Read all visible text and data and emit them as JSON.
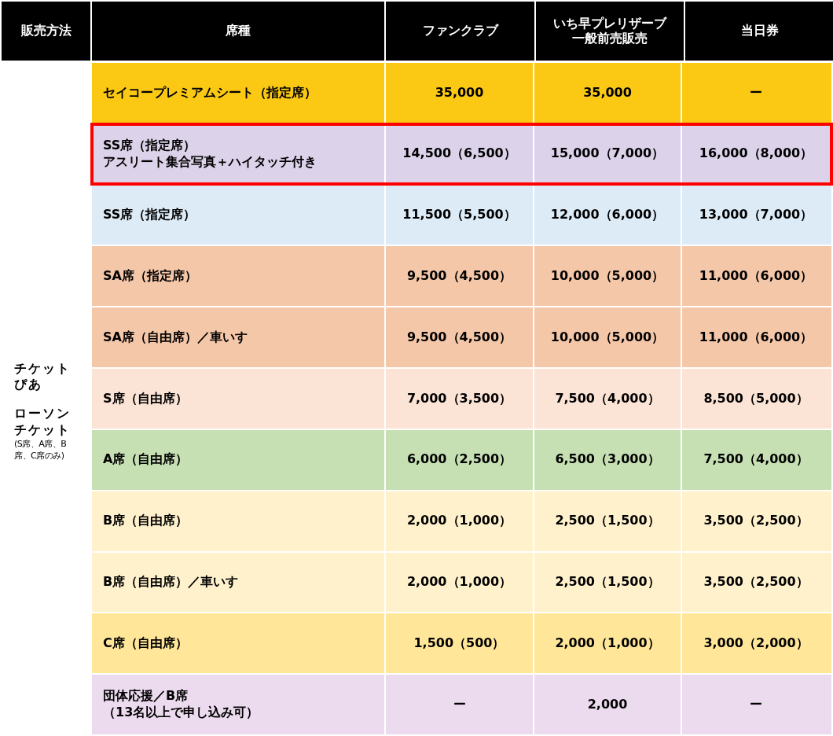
{
  "header": [
    "販売方法",
    "席種",
    "ファンクラブ",
    "いち早プレリザーブ一般前売販売",
    "当日券"
  ],
  "sales_methods": [
    {
      "kind": "main",
      "text": "チケットぴあ"
    },
    {
      "kind": "main",
      "text": "ローソンチケット"
    },
    {
      "kind": "note",
      "text": "(S席、A席、B席、C席のみ)"
    }
  ],
  "rows": [
    {
      "seat": "セイコープレミアムシート（指定席）",
      "fanclub": "35,000",
      "presale": "35,000",
      "day": "ー",
      "color": "#fbc913",
      "highlighted": false
    },
    {
      "seat": [
        "SS席（指定席）",
        "アスリート集合写真＋ハイタッチ付き"
      ],
      "fanclub": "14,500（6,500）",
      "presale": "15,000（7,000）",
      "day": "16,000（8,000）",
      "color": "#dcd2ea",
      "highlighted": true
    },
    {
      "seat": "SS席（指定席）",
      "fanclub": "11,500（5,500）",
      "presale": "12,000（6,000）",
      "day": "13,000（7,000）",
      "color": "#ddebf7",
      "highlighted": false
    },
    {
      "seat": "SA席（指定席）",
      "fanclub": "9,500（4,500）",
      "presale": "10,000（5,000）",
      "day": "11,000（6,000）",
      "color": "#f5c7a9",
      "highlighted": false
    },
    {
      "seat": "SA席（自由席）／車いす",
      "fanclub": "9,500（4,500）",
      "presale": "10,000（5,000）",
      "day": "11,000（6,000）",
      "color": "#f5c7a9",
      "highlighted": false
    },
    {
      "seat": "S席（自由席）",
      "fanclub": "7,000（3,500）",
      "presale": "7,500（4,000）",
      "day": "8,500（5,000）",
      "color": "#fbe4d6",
      "highlighted": false
    },
    {
      "seat": "A席（自由席）",
      "fanclub": "6,000（2,500）",
      "presale": "6,500（3,000）",
      "day": "7,500（4,000）",
      "color": "#c6e0b4",
      "highlighted": false
    },
    {
      "seat": "B席（自由席）",
      "fanclub": "2,000（1,000）",
      "presale": "2,500（1,500）",
      "day": "3,500（2,500）",
      "color": "#fff1cc",
      "highlighted": false
    },
    {
      "seat": "B席（自由席）／車いす",
      "fanclub": "2,000（1,000）",
      "presale": "2,500（1,500）",
      "day": "3,500（2,500）",
      "color": "#fff1cc",
      "highlighted": false
    },
    {
      "seat": "C席（自由席）",
      "fanclub": "1,500（500）",
      "presale": "2,000（1,000）",
      "day": "3,000（2,000）",
      "color": "#ffe699",
      "highlighted": false
    },
    {
      "seat": [
        "団体応援／B席",
        "（13名以上で申し込み可）"
      ],
      "fanclub": "ー",
      "presale": "2,000",
      "day": "ー",
      "color": "#ecdaee",
      "highlighted": false
    }
  ]
}
